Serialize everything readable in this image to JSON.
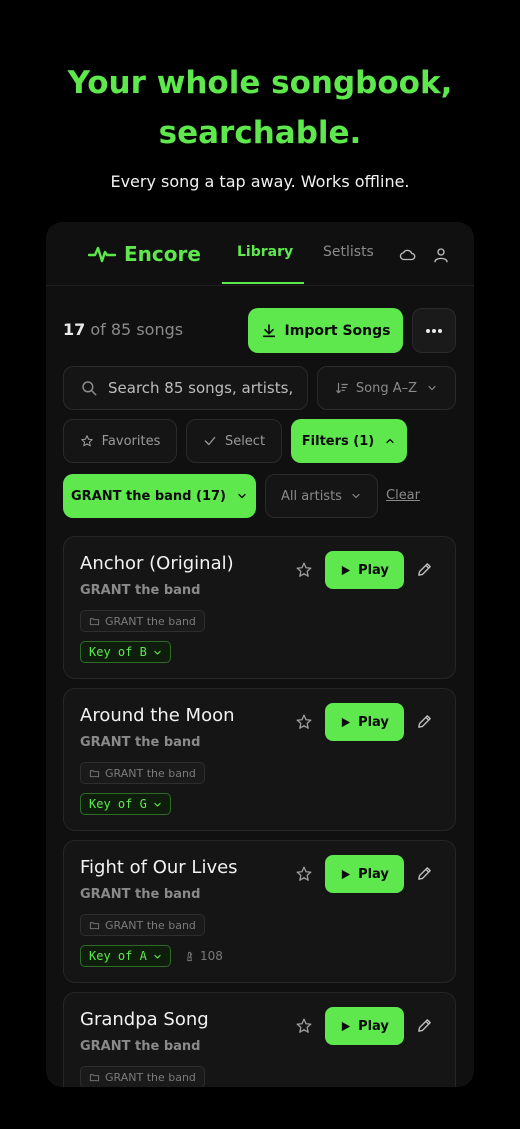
{
  "hero": {
    "title_line1": "Your whole songbook,",
    "title_line2": "searchable.",
    "subtitle": "Every song a tap away. Works offline."
  },
  "nav": {
    "brand": "Encore",
    "tabs": [
      {
        "label": "Library",
        "active": true
      },
      {
        "label": "Setlists",
        "active": false
      }
    ],
    "icons": [
      "cloud-icon",
      "user-icon"
    ]
  },
  "toolbar": {
    "count_shown": "17",
    "count_rest": "of 85 songs",
    "import_label": "Import Songs",
    "more_icon": "more-icon"
  },
  "search": {
    "placeholder": "Search 85 songs, artists, ...",
    "visible_text": "Search 85 songs, artists,"
  },
  "sort": {
    "label": "Song A–Z"
  },
  "chips": {
    "favorites": "Favorites",
    "select": "Select",
    "filters": "Filters (1)"
  },
  "artist_filter": {
    "selected": "GRANT the band (17)",
    "all_artists": "All artists",
    "clear": "Clear"
  },
  "songs": [
    {
      "title": "Anchor (Original)",
      "artist": "GRANT the band",
      "folder": "GRANT the band",
      "key": "Key of B",
      "bpm": ""
    },
    {
      "title": "Around the Moon",
      "artist": "GRANT the band",
      "folder": "GRANT the band",
      "key": "Key of G",
      "bpm": ""
    },
    {
      "title": "Fight of Our Lives",
      "artist": "GRANT the band",
      "folder": "GRANT the band",
      "key": "Key of A",
      "bpm": "108"
    },
    {
      "title": "Grandpa Song",
      "artist": "GRANT the band",
      "folder": "GRANT the band",
      "key": "",
      "bpm": ""
    }
  ],
  "song_actions": {
    "play": "Play"
  },
  "colors": {
    "accent": "#5ee84e",
    "background": "#000000",
    "surface": "#101010",
    "card": "#151515"
  }
}
